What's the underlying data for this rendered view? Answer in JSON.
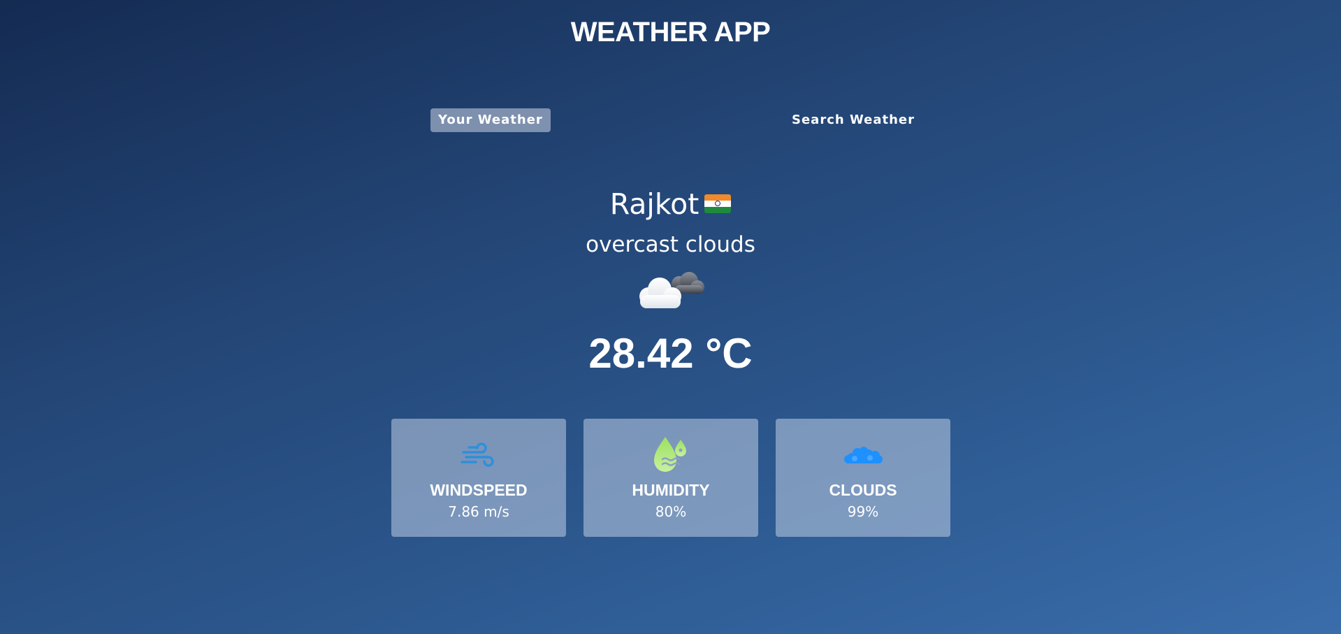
{
  "header": {
    "title": "WEATHER APP"
  },
  "tabs": [
    {
      "label": "Your Weather",
      "active": true
    },
    {
      "label": "Search Weather",
      "active": false
    }
  ],
  "weather": {
    "city": "Rajkot",
    "country_flag_icon": "india-flag-icon",
    "description": "overcast clouds",
    "condition_icon": "overcast-clouds-icon",
    "temperature": "28.42 °C"
  },
  "stats": [
    {
      "icon": "wind-icon",
      "label": "WINDSPEED",
      "value": "7.86 m/s",
      "icon_color": "#2f8fd9"
    },
    {
      "icon": "humidity-drops-icon",
      "label": "HUMIDITY",
      "value": "80%",
      "icon_color": "#a8e86a"
    },
    {
      "icon": "clouds-icon",
      "label": "CLOUDS",
      "value": "99%",
      "icon_color": "#1e90ff"
    }
  ],
  "colors": {
    "background_start": "#142b52",
    "background_end": "#3a6dab",
    "active_tab": "#8fa3c4",
    "card": "#8aa0c2"
  }
}
